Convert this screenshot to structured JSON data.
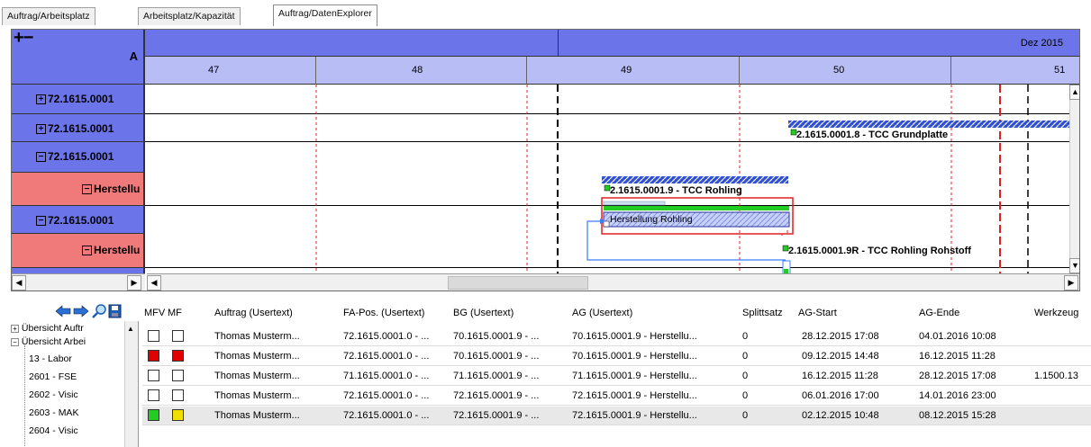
{
  "tabs": [
    {
      "label": "Auftrag/Arbeitsplatz"
    },
    {
      "label": "Arbeitsplatz/Kapazität"
    },
    {
      "label": "Auftrag/DatenExplorer"
    }
  ],
  "gantt": {
    "corner_symbols": "+−",
    "corner_label": "A",
    "month_label": "Dez 2015",
    "weeks": [
      "47",
      "48",
      "49",
      "50",
      "51"
    ],
    "rows": [
      {
        "label": "72.1615.0001",
        "type": "blue",
        "expand": "+"
      },
      {
        "label": "72.1615.0001",
        "type": "blue",
        "expand": "+"
      },
      {
        "label": "72.1615.0001",
        "type": "blue",
        "expand": "−"
      },
      {
        "label": "Herstellu",
        "type": "red",
        "expand": "−"
      },
      {
        "label": "72.1615.0001",
        "type": "blue",
        "expand": "−"
      },
      {
        "label": "Herstellu",
        "type": "red",
        "expand": "−"
      }
    ],
    "bars": {
      "grundplatte": "2.1615.0001.8 - TCC Grundplatte",
      "rohling": "2.1615.0001.9 - TCC Rohling",
      "herstellung": "Herstellung Rohling",
      "rohstoff": "2.1615.0001.9R - TCC Rohling Rohstoff"
    }
  },
  "toolbar": {
    "icons": [
      "back-arrow-icon",
      "forward-arrow-icon",
      "search-icon",
      "save-icon"
    ]
  },
  "tree": {
    "items": [
      {
        "label": "Übersicht Auftr",
        "expand": "+"
      },
      {
        "label": "Übersicht Arbei",
        "expand": "−"
      },
      {
        "label": "13 - Labor"
      },
      {
        "label": "2601 - FSE"
      },
      {
        "label": "2602 - Visic"
      },
      {
        "label": "2603 - MAK"
      },
      {
        "label": "2604 - Visic"
      }
    ]
  },
  "table": {
    "headers": [
      "MFV",
      "MF",
      "Auftrag (Usertext)",
      "FA-Pos. (Usertext)",
      "BG (Usertext)",
      "AG (Usertext)",
      "Splittsatz",
      "AG-Start",
      "AG-Ende",
      "Werkzeug"
    ],
    "rows": [
      {
        "mfv": "#ffffff",
        "mf": "#ffffff",
        "auftrag": "Thomas Musterm...",
        "fapos": "72.1615.0001.0 - ...",
        "bg": "70.1615.0001.9 - ...",
        "ag": "70.1615.0001.9 - Herstellu...",
        "split": "0",
        "start": "28.12.2015 17:08",
        "ende": "04.01.2016 10:08",
        "werkzeug": ""
      },
      {
        "mfv": "#e00000",
        "mf": "#e00000",
        "auftrag": "Thomas Musterm...",
        "fapos": "72.1615.0001.0 - ...",
        "bg": "70.1615.0001.9 - ...",
        "ag": "70.1615.0001.9 - Herstellu...",
        "split": "0",
        "start": "09.12.2015 14:48",
        "ende": "16.12.2015 11:28",
        "werkzeug": ""
      },
      {
        "mfv": "#ffffff",
        "mf": "#ffffff",
        "auftrag": "Thomas Musterm...",
        "fapos": "71.1615.0001.0 - ...",
        "bg": "71.1615.0001.9 - ...",
        "ag": "71.1615.0001.9 - Herstellu...",
        "split": "0",
        "start": "16.12.2015 11:28",
        "ende": "28.12.2015 17:08",
        "werkzeug": "1.1500.13"
      },
      {
        "mfv": "#ffffff",
        "mf": "#ffffff",
        "auftrag": "Thomas Musterm...",
        "fapos": "72.1615.0001.0 - ...",
        "bg": "72.1615.0001.9 - ...",
        "ag": "72.1615.0001.9 - Herstellu...",
        "split": "0",
        "start": "06.01.2016 17:00",
        "ende": "14.01.2016 23:00",
        "werkzeug": ""
      },
      {
        "mfv": "#22cc22",
        "mf": "#f0e000",
        "auftrag": "Thomas Musterm...",
        "fapos": "72.1615.0001.0 - ...",
        "bg": "72.1615.0001.9 - ...",
        "ag": "72.1615.0001.9 - Herstellu...",
        "split": "0",
        "start": "02.12.2015 10:48",
        "ende": "08.12.2015 15:28",
        "werkzeug": ""
      }
    ]
  }
}
